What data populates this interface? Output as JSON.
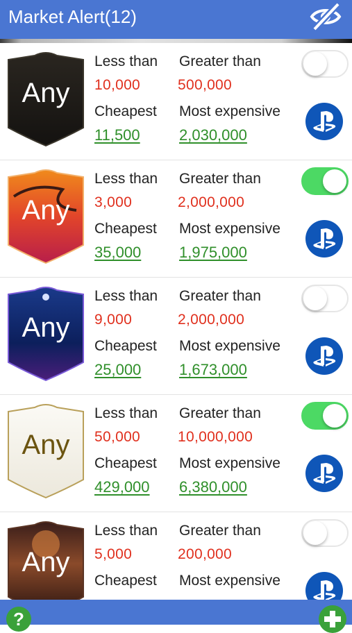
{
  "header": {
    "title": "Market Alert(12)",
    "hide_icon": "eye-slash-icon"
  },
  "labels": {
    "less_than": "Less than",
    "greater_than": "Greater than",
    "cheapest": "Cheapest",
    "most_expensive": "Most expensive"
  },
  "alerts": [
    {
      "card": "Any",
      "card_style": "black",
      "enabled": false,
      "platform": "playstation",
      "less_than": "10,000",
      "greater_than": "500,000",
      "cheapest": "11,500",
      "most_expensive": "2,030,000"
    },
    {
      "card": "Any",
      "card_style": "orange-red",
      "enabled": true,
      "platform": "playstation",
      "less_than": "3,000",
      "greater_than": "2,000,000",
      "cheapest": "35,000",
      "most_expensive": "1,975,000"
    },
    {
      "card": "Any",
      "card_style": "blue-purple",
      "enabled": false,
      "platform": "playstation",
      "less_than": "9,000",
      "greater_than": "2,000,000",
      "cheapest": "25,000",
      "most_expensive": "1,673,000"
    },
    {
      "card": "Any",
      "card_style": "white-gold",
      "enabled": true,
      "platform": "playstation",
      "less_than": "50,000",
      "greater_than": "10,000,000",
      "cheapest": "429,000",
      "most_expensive": "6,380,000"
    },
    {
      "card": "Any",
      "card_style": "brown-sunset",
      "enabled": false,
      "platform": "playstation",
      "less_than": "5,000",
      "greater_than": "200,000",
      "cheapest": "",
      "most_expensive": ""
    }
  ],
  "footer": {
    "help_label": "?",
    "add_icon": "plus-icon"
  },
  "colors": {
    "header": "#4a76d2",
    "threshold_red": "#e0301e",
    "price_green": "#2f8f2a",
    "toggle_on": "#4cd964",
    "playstation_blue": "#0f56b8"
  }
}
